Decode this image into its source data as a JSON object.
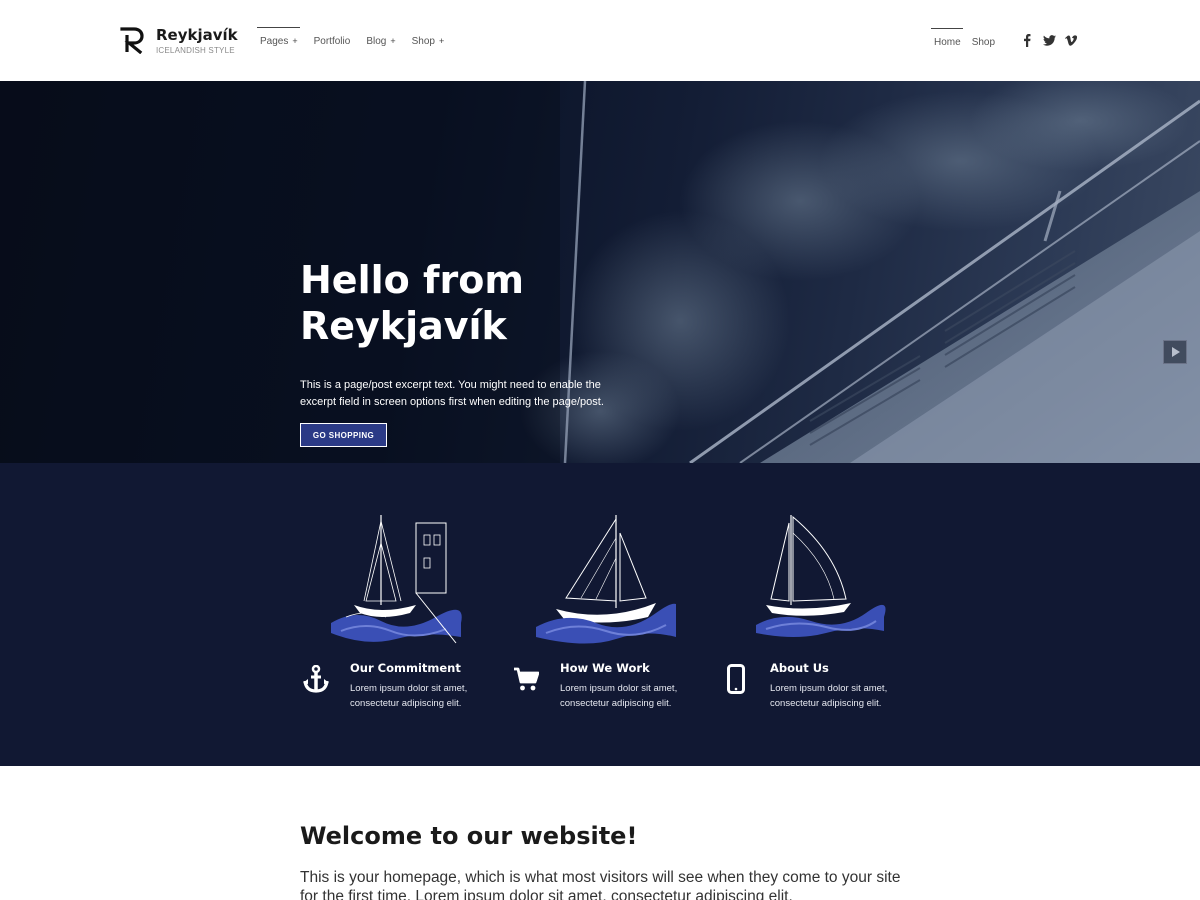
{
  "header": {
    "site_title": "Reykjavík",
    "tagline": "ICELANDISH STYLE",
    "nav": [
      {
        "label": "Pages",
        "has_submenu": true,
        "active": true
      },
      {
        "label": "Portfolio",
        "has_submenu": false
      },
      {
        "label": "Blog",
        "has_submenu": true
      },
      {
        "label": "Shop",
        "has_submenu": true
      }
    ],
    "secondary_nav": [
      {
        "label": "Home",
        "active": true
      },
      {
        "label": "Shop"
      }
    ],
    "social": [
      "facebook-icon",
      "twitter-icon",
      "vimeo-icon"
    ]
  },
  "hero": {
    "title_line1": "Hello from",
    "title_line2": "Reykjavík",
    "excerpt": "This is a page/post excerpt text. You might need to enable the excerpt field in screen options first when editing the page/post.",
    "button_label": "GO SHOPPING",
    "next_icon": "play-next-icon"
  },
  "features": [
    {
      "icon": "anchor-icon",
      "title": "Our Commitment",
      "text": "Lorem ipsum dolor sit amet, consectetur adipiscing elit."
    },
    {
      "icon": "cart-icon",
      "title": "How We Work",
      "text": "Lorem ipsum dolor sit amet, consectetur adipiscing elit."
    },
    {
      "icon": "mobile-icon",
      "title": "About Us",
      "text": "Lorem ipsum dolor sit amet, consectetur adipiscing elit."
    }
  ],
  "welcome": {
    "title": "Welcome to our website!",
    "text": "This is your homepage, which is what most visitors will see when they come to your site for the first time. Lorem ipsum dolor sit amet, consectetur adipiscing elit."
  },
  "colors": {
    "navy": "#111833",
    "button_blue": "#2b3a86",
    "wave_blue": "#3a4fb5"
  }
}
